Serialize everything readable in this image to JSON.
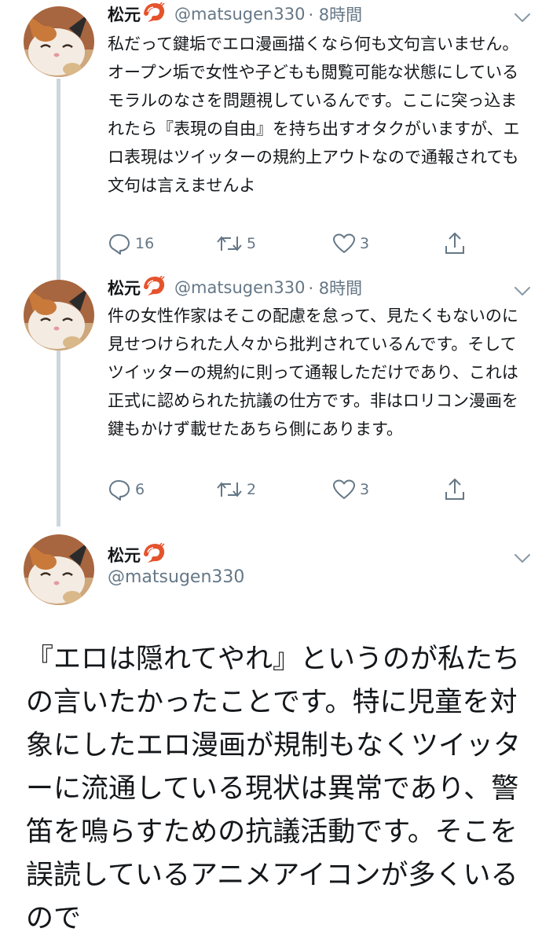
{
  "tweets": [
    {
      "name": "松元",
      "handle": "@matsugen330",
      "time": "· 8時間",
      "text": "私だって鍵垢でエロ漫画描くなら何も文句言いません。オープン垢で女性や子どもも閲覧可能な状態にしているモラルのなさを問題視しているんです。ここに突っ込まれたら『表現の自由』を持ち出すオタクがいますが、エロ表現はツイッターの規約上アウトなので通報されても文句は言えませんよ",
      "replies": "16",
      "retweets": "5",
      "likes": "3"
    },
    {
      "name": "松元",
      "handle": "@matsugen330",
      "time": "· 8時間",
      "text": "件の女性作家はそこの配慮を怠って、見たくもないのに見せつけられた人々から批判されているんです。そしてツイッターの規約に則って通報しただけであり、これは正式に認められた抗議の仕方です。非はロリコン漫画を鍵もかけず載せたあちら側にあります。",
      "replies": "6",
      "retweets": "2",
      "likes": "3"
    }
  ],
  "main_tweet": {
    "name": "松元",
    "handle": "@matsugen330",
    "text": "『エロは隠れてやれ』というのが私たちの言いたかったことです。特に児童を対象にしたエロ漫画が規制もなくツイッターに流通している現状は異常であり、警笛を鳴らすための抗議活動です。そこを誤読しているアニメアイコンが多くいるので"
  },
  "icons": {
    "author_badge": "shrimp-emoji",
    "menu": "chevron-down-icon",
    "reply": "reply-icon",
    "retweet": "retweet-icon",
    "like": "heart-icon",
    "share": "share-icon"
  },
  "colors": {
    "text": "#14171a",
    "secondary": "#657786",
    "thread_line": "#ccd6dd"
  }
}
